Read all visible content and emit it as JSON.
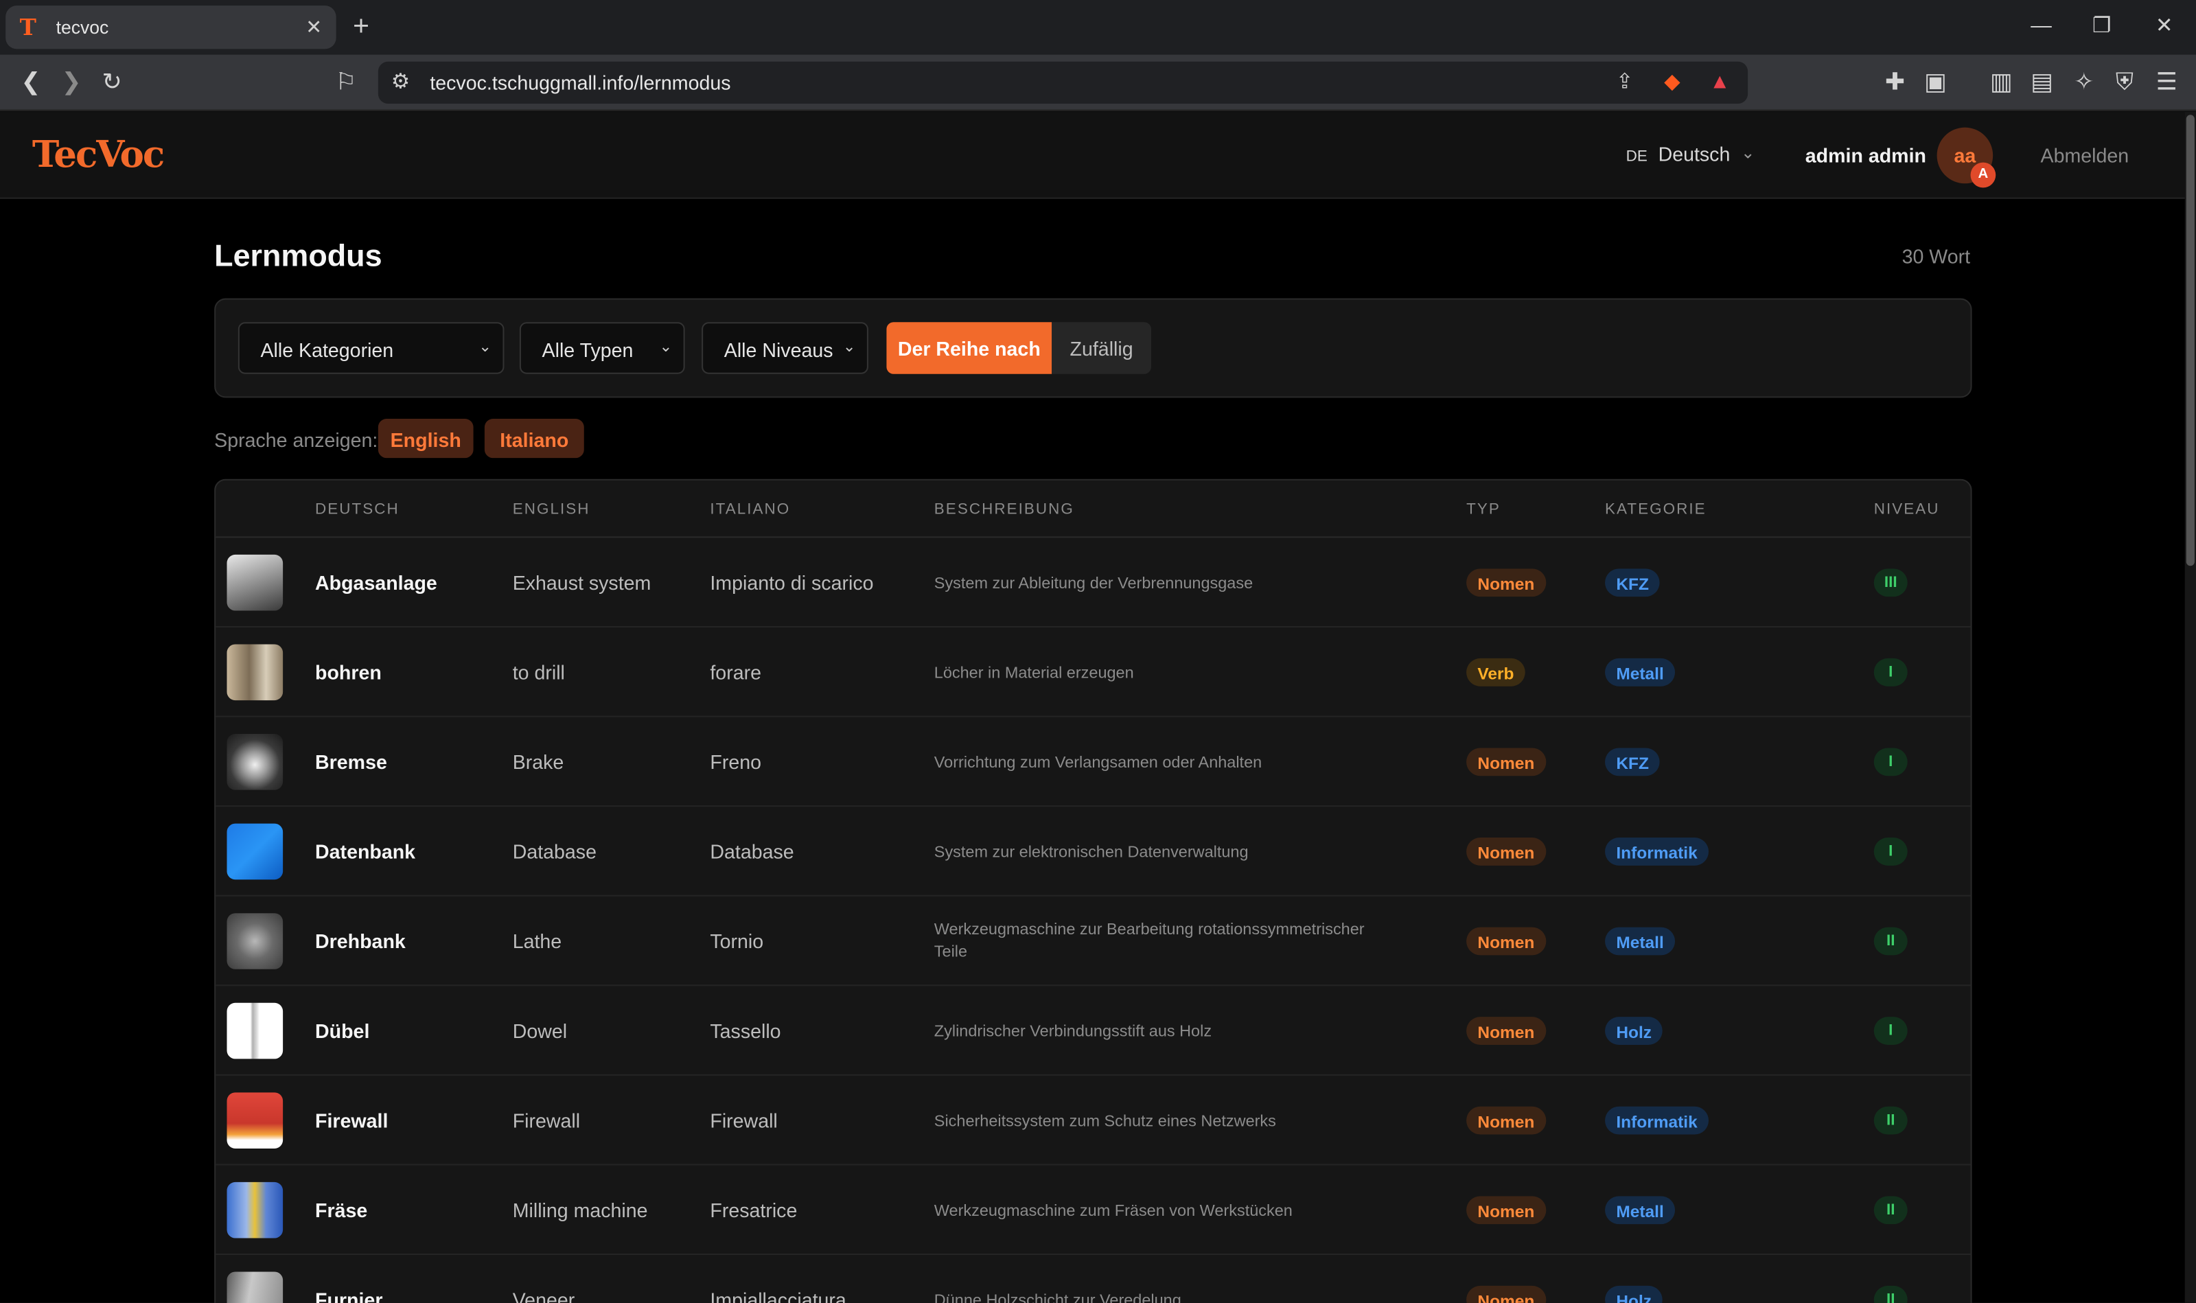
{
  "browser": {
    "tab_title": "tecvoc",
    "url": "tecvoc.tschuggmall.info/lernmodus"
  },
  "header": {
    "logo": "TecVoc",
    "lang_code": "DE",
    "language": "Deutsch",
    "user_name": "admin admin",
    "avatar_initials": "aa",
    "avatar_badge": "A",
    "logout": "Abmelden"
  },
  "page": {
    "title": "Lernmodus",
    "word_count": "30 Wort"
  },
  "filters": {
    "category": "Alle Kategorien",
    "type": "Alle Typen",
    "level": "Alle Niveaus",
    "order_sequential": "Der Reihe nach",
    "order_random": "Zufällig"
  },
  "display_langs": {
    "label": "Sprache anzeigen:",
    "items": [
      "English",
      "Italiano"
    ]
  },
  "table": {
    "headers": [
      "DEUTSCH",
      "ENGLISH",
      "ITALIANO",
      "BESCHREIBUNG",
      "TYP",
      "KATEGORIE",
      "NIVEAU"
    ],
    "rows": [
      {
        "de": "Abgasanlage",
        "en": "Exhaust system",
        "it": "Impianto di scarico",
        "desc": "System zur Ableitung der Verbrennungsgase",
        "type": "Nomen",
        "cat": "KFZ",
        "lvl": "III"
      },
      {
        "de": "bohren",
        "en": "to drill",
        "it": "forare",
        "desc": "Löcher in Material erzeugen",
        "type": "Verb",
        "cat": "Metall",
        "lvl": "I"
      },
      {
        "de": "Bremse",
        "en": "Brake",
        "it": "Freno",
        "desc": "Vorrichtung zum Verlangsamen oder Anhalten",
        "type": "Nomen",
        "cat": "KFZ",
        "lvl": "I"
      },
      {
        "de": "Datenbank",
        "en": "Database",
        "it": "Database",
        "desc": "System zur elektronischen Datenverwaltung",
        "type": "Nomen",
        "cat": "Informatik",
        "lvl": "I"
      },
      {
        "de": "Drehbank",
        "en": "Lathe",
        "it": "Tornio",
        "desc": "Werkzeugmaschine zur Bearbeitung rotationssymmetrischer Teile",
        "type": "Nomen",
        "cat": "Metall",
        "lvl": "II"
      },
      {
        "de": "Dübel",
        "en": "Dowel",
        "it": "Tassello",
        "desc": "Zylindrischer Verbindungsstift aus Holz",
        "type": "Nomen",
        "cat": "Holz",
        "lvl": "I"
      },
      {
        "de": "Firewall",
        "en": "Firewall",
        "it": "Firewall",
        "desc": "Sicherheitssystem zum Schutz eines Netzwerks",
        "type": "Nomen",
        "cat": "Informatik",
        "lvl": "II"
      },
      {
        "de": "Fräse",
        "en": "Milling machine",
        "it": "Fresatrice",
        "desc": "Werkzeugmaschine zum Fräsen von Werkstücken",
        "type": "Nomen",
        "cat": "Metall",
        "lvl": "II"
      },
      {
        "de": "Furnier",
        "en": "Veneer",
        "it": "Impiallacciatura",
        "desc": "Dünne Holzschicht zur Veredelung",
        "type": "Nomen",
        "cat": "Holz",
        "lvl": "II"
      }
    ]
  },
  "colors": {
    "accent": "#f26a2b",
    "background": "#000000",
    "panel": "#161616"
  }
}
